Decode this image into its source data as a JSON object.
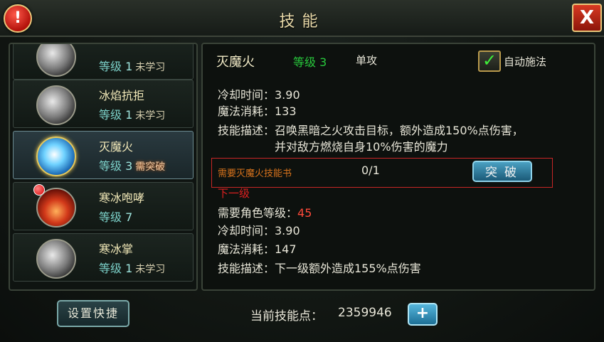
{
  "window": {
    "title": "技能",
    "close_glyph": "X",
    "alert_glyph": "!"
  },
  "skills": [
    {
      "name": "",
      "level_prefix": "等级",
      "level": "1",
      "status": "未学习",
      "icon": "frost-orb-icon"
    },
    {
      "name": "冰焰抗拒",
      "level_prefix": "等级",
      "level": "1",
      "status": "未学习",
      "icon": "ice-flame-icon"
    },
    {
      "name": "灭魔火",
      "level_prefix": "等级",
      "level": "3",
      "status": "需突破",
      "icon": "demon-fire-icon"
    },
    {
      "name": "寒冰咆哮",
      "level_prefix": "等级",
      "level": "7",
      "status": "",
      "icon": "ice-roar-icon"
    },
    {
      "name": "寒冰掌",
      "level_prefix": "等级",
      "level": "1",
      "status": "未学习",
      "icon": "ice-palm-icon"
    }
  ],
  "detail": {
    "name": "灭魔火",
    "level_text": "等级 3",
    "attack_type": "单攻",
    "auto_cast_label": "自动施法",
    "auto_cast_checked": true,
    "cooldown": "冷却时间：3.90",
    "mana": "魔法消耗：133",
    "desc_line1": "技能描述：召唤黑暗之火攻击目标，额外造成150%点伤害，",
    "desc_line2": "并对敌方燃烧自身10%伤害的魔力",
    "requirement_label": "需要灭魔火技能书",
    "requirement_count": "0/1",
    "break_button": "突破",
    "next_title": "下一级",
    "next_req_label": "需要角色等级：",
    "next_req_level": "45",
    "next_cooldown": "冷却时间：3.90",
    "next_mana": "魔法消耗：147",
    "next_desc": "技能描述：下一级额外造成155%点伤害"
  },
  "footer": {
    "set_shortcut": "设置快捷",
    "points_label": "当前技能点：",
    "points_value": "2359946",
    "plus_glyph": "+"
  },
  "colors": {
    "accent_green": "#28c83c",
    "alert_red": "#e02020",
    "title_gold": "#e8d9a8"
  }
}
